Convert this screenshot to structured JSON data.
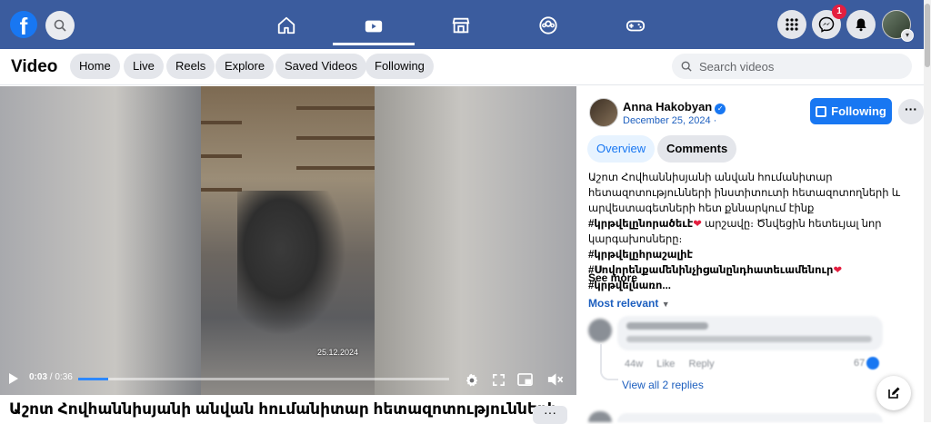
{
  "topbar": {
    "logo": "f",
    "nav_icons": [
      "home-icon",
      "video-icon",
      "marketplace-icon",
      "groups-icon",
      "gaming-icon"
    ],
    "active_nav": "video-icon",
    "notifications_badge": "1"
  },
  "subbar": {
    "title": "Video",
    "tabs": [
      "Home",
      "Live",
      "Reels",
      "Explore",
      "Saved Videos",
      "Following"
    ],
    "search_placeholder": "Search videos"
  },
  "player": {
    "date_stamp": "25.12.2024",
    "current_time": "0:03",
    "duration": "0:36",
    "progress_fraction": 0.08
  },
  "video_title": "Աշոտ Հովհաննիսյանի անվան հումանիտար հետազոտությունների",
  "post": {
    "author": "Anna Hakobyan",
    "date": "December 25, 2024 ·",
    "follow_label": "Following",
    "tabs": {
      "overview": "Overview",
      "comments": "Comments"
    },
    "desc_plain": "Աշոտ Հովհաննիսյանի անվան հումանիտար հետազոտությունների ինստիտուտի հետազոտողների և արվեստագետների հետ քննարկում էինք",
    "desc_tag1": "#կրթվելընորածեւէ",
    "desc_plain2": "արշավը։ Ծնվեցին հետեւյալ նոր կարգախոսները։",
    "desc_tag2": "#կրթվելըհրաշալիէ",
    "desc_tag3": "#Սովորենքամենինչիցանընդհատեւամենուր",
    "desc_tag4": "#կրթվելնառո...",
    "see_more": "See more",
    "sort_label": "Most relevant",
    "view_replies": "View all 2 replies"
  },
  "comment": {
    "time": "44w",
    "like": "Like",
    "reply": "Reply",
    "reactions": "67"
  },
  "colors": {
    "accent": "#1877f2",
    "topbar": "#3b5c9e"
  }
}
